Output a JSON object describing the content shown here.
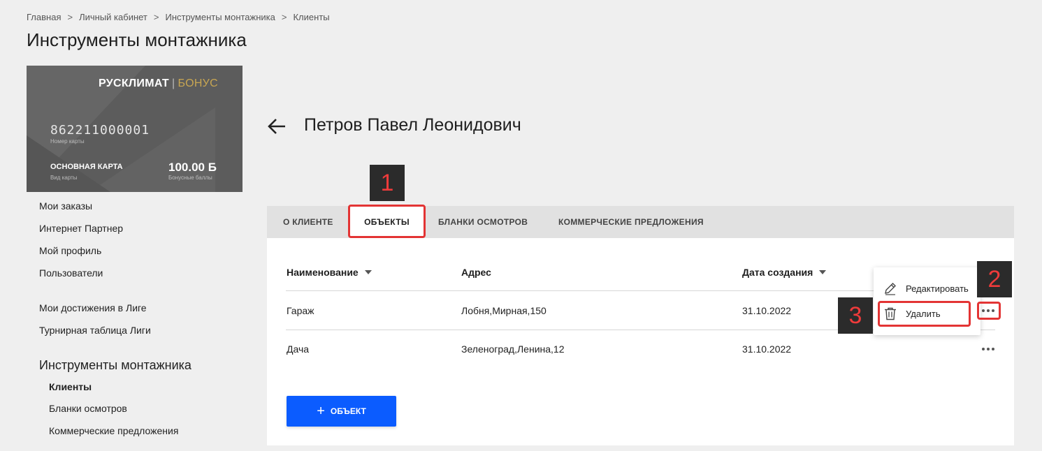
{
  "breadcrumb": {
    "items": [
      "Главная",
      "Личный кабинет",
      "Инструменты монтажника",
      "Клиенты"
    ],
    "separator": ">"
  },
  "page_title": "Инструменты монтажника",
  "card": {
    "brand": "РУСКЛИМАТ",
    "brand_separator": "|",
    "brand_suffix": "БОНУС",
    "number": "862211000001",
    "number_label": "Номер карты",
    "type": "ОСНОВНАЯ КАРТА",
    "type_label": "Вид карты",
    "points": "100.00 Б",
    "points_label": "Бонусные баллы"
  },
  "sidebar": {
    "items": [
      "Мои заказы",
      "Интернет Партнер",
      "Мой профиль",
      "Пользователи"
    ],
    "league_items": [
      "Мои достижения в Лиге",
      "Турнирная таблица Лиги"
    ],
    "section_title": "Инструменты монтажника",
    "sub_items": [
      "Клиенты",
      "Бланки осмотров",
      "Коммерческие предложения"
    ]
  },
  "client": {
    "name": "Петров Павел Леонидович"
  },
  "tabs": [
    "О КЛИЕНТЕ",
    "ОБЪЕКТЫ",
    "БЛАНКИ ОСМОТРОВ",
    "КОММЕРЧЕСКИЕ ПРЕДЛОЖЕНИЯ"
  ],
  "active_tab": "ОБЪЕКТЫ",
  "table": {
    "columns": [
      "Наименование",
      "Адрес",
      "Дата создания"
    ],
    "rows": [
      {
        "name": "Гараж",
        "address": "Лобня,Мирная,150",
        "date": "31.10.2022"
      },
      {
        "name": "Дача",
        "address": "Зеленоград,Ленина,12",
        "date": "31.10.2022"
      }
    ]
  },
  "add_button": {
    "label": "ОБЪЕКТ",
    "icon": "plus-icon"
  },
  "context_menu": {
    "items": [
      {
        "label": "Редактировать",
        "icon": "pencil-icon"
      },
      {
        "label": "Удалить",
        "icon": "trash-icon"
      }
    ]
  },
  "annotations": [
    "1",
    "2",
    "3"
  ],
  "colors": {
    "accent": "#0b5cff",
    "highlight": "#e33434",
    "bonus_gold": "#c8a652",
    "card_bg": "#5c5c5c"
  }
}
